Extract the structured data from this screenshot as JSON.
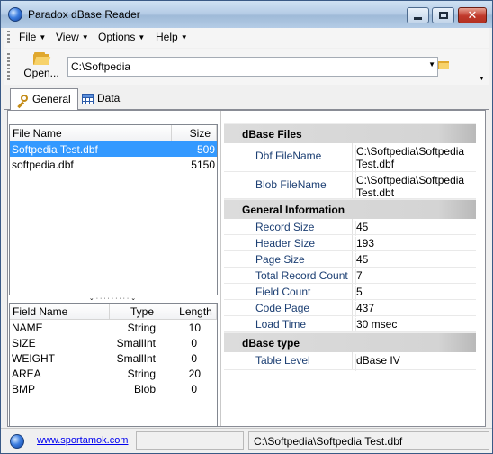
{
  "window": {
    "title": "Paradox dBase Reader",
    "close_glyph": "✕"
  },
  "menu": [
    {
      "label": "File"
    },
    {
      "label": "View"
    },
    {
      "label": "Options"
    },
    {
      "label": "Help"
    }
  ],
  "toolbar": {
    "open_label": "Open...",
    "path": "C:\\Softpedia"
  },
  "tabs": [
    {
      "label": "General",
      "icon": "key-icon"
    },
    {
      "label": "Data",
      "icon": "grid-icon"
    }
  ],
  "files": {
    "headers": {
      "name": "File Name",
      "size": "Size"
    },
    "rows": [
      {
        "name": "Softpedia Test.dbf",
        "size": "509",
        "selected": true
      },
      {
        "name": "softpedia.dbf",
        "size": "5150",
        "selected": false
      }
    ]
  },
  "fields": {
    "headers": {
      "name": "Field Name",
      "type": "Type",
      "length": "Length"
    },
    "rows": [
      {
        "name": "NAME",
        "type": "String",
        "length": "10"
      },
      {
        "name": "SIZE",
        "type": "SmallInt",
        "length": "0"
      },
      {
        "name": "WEIGHT",
        "type": "SmallInt",
        "length": "0"
      },
      {
        "name": "AREA",
        "type": "String",
        "length": "20"
      },
      {
        "name": "BMP",
        "type": "Blob",
        "length": "0"
      }
    ]
  },
  "properties": {
    "files_cat": "dBase Files",
    "dbf_name": "Dbf FileName",
    "dbf_val1": "C:\\Softpedia\\Softpedia",
    "dbf_val2": "Test.dbf",
    "blob_name": "Blob FileName",
    "blob_val1": "C:\\Softpedia\\Softpedia",
    "blob_val2": "Test.dbt",
    "general_cat": "General Information",
    "general": [
      {
        "name": "Record Size",
        "value": "45"
      },
      {
        "name": "Header Size",
        "value": "193"
      },
      {
        "name": "Page Size",
        "value": "45"
      },
      {
        "name": "Total Record Count",
        "value": "7"
      },
      {
        "name": "Field Count",
        "value": "5"
      },
      {
        "name": "Code Page",
        "value": "437"
      },
      {
        "name": "Load Time",
        "value": "30 msec"
      }
    ],
    "type_cat": "dBase type",
    "table_level_name": "Table Level",
    "table_level_value": "dBase IV"
  },
  "status": {
    "link": "www.sportamok.com",
    "file": "C:\\Softpedia\\Softpedia Test.dbf"
  },
  "colors": {
    "selection": "#3399ff",
    "prop_name": "#1c3f73"
  }
}
